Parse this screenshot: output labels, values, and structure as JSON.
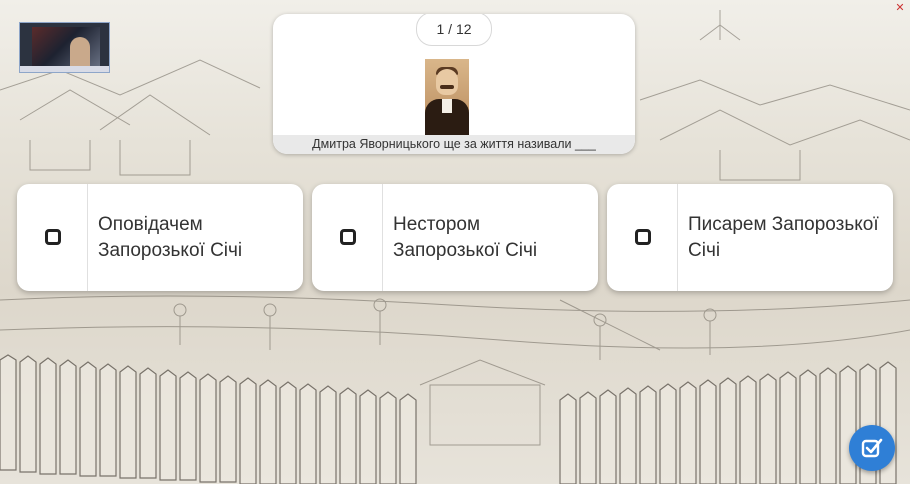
{
  "thumbnail": {
    "icon": "video-thumbnail"
  },
  "close": {
    "glyph": "✕"
  },
  "question": {
    "counter": "1 / 12",
    "text": "Дмитра Яворницького ще за життя називали ___",
    "image": "portrait-photo"
  },
  "options": [
    {
      "label": "Оповідачем Запорозької Січі"
    },
    {
      "label": "Нестором Запорозької Січі"
    },
    {
      "label": "Писарем Запорозької Січі"
    }
  ],
  "submit": {
    "icon": "check-submit-icon",
    "color": "#2f7fd6"
  }
}
